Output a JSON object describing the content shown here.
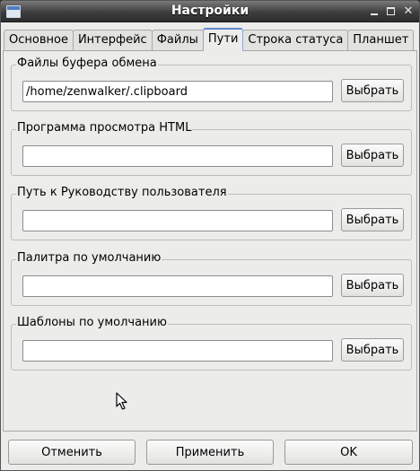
{
  "window": {
    "title": "Настройки"
  },
  "tabs": [
    {
      "label": "Основное"
    },
    {
      "label": "Интерфейс"
    },
    {
      "label": "Файлы"
    },
    {
      "label": "Пути",
      "active": true
    },
    {
      "label": "Строка статуса"
    },
    {
      "label": "Планшет"
    }
  ],
  "paths": {
    "clipboard": {
      "label": "Файлы буфера обмена",
      "value": "/home/zenwalker/.clipboard",
      "button": "Выбрать"
    },
    "html_viewer": {
      "label": "Программа просмотра HTML",
      "value": "",
      "button": "Выбрать"
    },
    "user_guide": {
      "label": "Путь к Руководству пользователя",
      "value": "",
      "button": "Выбрать"
    },
    "palette": {
      "label": "Палитра по умолчанию",
      "value": "",
      "button": "Выбрать"
    },
    "templates": {
      "label": "Шаблоны по умолчанию",
      "value": "",
      "button": "Выбрать"
    }
  },
  "footer": {
    "cancel": "Отменить",
    "apply": "Применить",
    "ok": "OK"
  },
  "colors": {
    "active_tab_accent": "#5e8ad0",
    "titlebar": "#3e3e3e"
  }
}
